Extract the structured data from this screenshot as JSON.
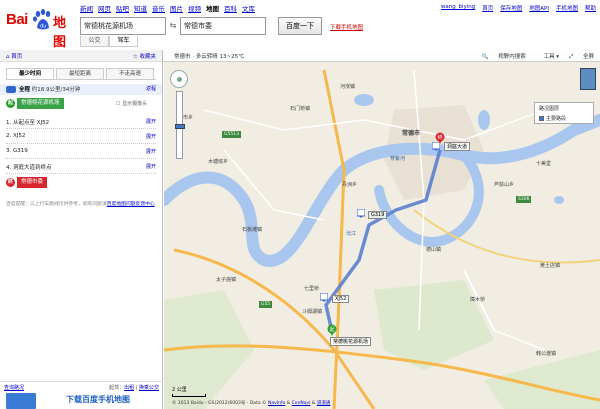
{
  "header": {
    "logo_text": "Bai",
    "logo_suffix": "地图",
    "nav": [
      "新闻",
      "网页",
      "贴吧",
      "知道",
      "音乐",
      "图片",
      "视频",
      "地图",
      "百科",
      "文库"
    ],
    "nav_active_index": 7,
    "from_value": "常德桃花源机场",
    "to_value": "常德市委",
    "search_button": "百度一下",
    "modes": [
      "公交",
      "驾车"
    ],
    "selected_mode": "驾车",
    "download_link": "下载手机地图",
    "user_links": [
      "wang_biying",
      "首页",
      "保存地图",
      "地图API",
      "手机地图",
      "帮助"
    ],
    "accent_color": "#e10602"
  },
  "sidebar": {
    "home": "首页",
    "collect": "收藏夹",
    "plan_tabs": [
      "最少时间",
      "最短距离",
      "不走高速"
    ],
    "selected_plan": 0,
    "summary_badge": "全程",
    "summary_text": "约18.9公里/34分钟",
    "swap_link": "返程",
    "start_label": "常德桃花源机场",
    "end_label": "常德市委",
    "show_camera": "显示摄像头",
    "steps": [
      {
        "text": "1. 从起点至 XJ52",
        "action": "展开"
      },
      {
        "text": "2. XJ52",
        "action": "展开"
      },
      {
        "text": "3. G319",
        "action": "展开"
      },
      {
        "text": "4. 洞庭大道到终点",
        "action": "展开"
      }
    ],
    "note_text": "百度提醒：以上行车路线仅供参考，如有问题请",
    "note_link": "百度地图问题反馈中心",
    "foot_left": "查询路况",
    "foot_right_label": "起驾：",
    "foot_right_links": [
      "出租",
      "换乘公交"
    ],
    "download_banner": "下载百度手机地图"
  },
  "map": {
    "crumb": "常德市 · 多云转晴 13~25℃",
    "tools": [
      "视野内搜索",
      "工具",
      "全屏"
    ],
    "layer_title": "路况图层",
    "layer_item": "主要路段",
    "overview_label": "卫星",
    "scale_label": "2 公里",
    "copyright": "© 2013 Baidu - GS(2012)6003号 - Data ©",
    "copyright_links": [
      "NavInfo",
      "CenNavi",
      "道道通"
    ],
    "cities": [
      {
        "name": "常德市"
      },
      {
        "name": "河洑镇"
      },
      {
        "name": "石门桥镇"
      },
      {
        "name": "木塘垸乡"
      },
      {
        "name": "丹洲乡"
      },
      {
        "name": "斗姆湖镇"
      },
      {
        "name": "德山镇"
      },
      {
        "name": "芦荻山乡"
      },
      {
        "name": "七里桥"
      },
      {
        "name": "石板滩镇"
      },
      {
        "name": "太子庙镇"
      },
      {
        "name": "樟木桥"
      },
      {
        "name": "黄土店镇"
      },
      {
        "name": "岗市乡"
      },
      {
        "name": "十美堂"
      },
      {
        "name": "韩公渡镇"
      }
    ],
    "rivers": [
      {
        "name": "沅江"
      },
      {
        "name": "穿紫河"
      }
    ],
    "roads": [
      {
        "name": "G319"
      },
      {
        "name": "G5513"
      },
      {
        "name": "G55"
      },
      {
        "name": "S306"
      }
    ],
    "pins": [
      {
        "label": "XJ52"
      },
      {
        "label": "G319"
      },
      {
        "label": "洞庭大道"
      }
    ],
    "start_pin_label": "常德桃花源机场",
    "route_color": "#5a7fcf",
    "river_color": "#aac8ee"
  }
}
